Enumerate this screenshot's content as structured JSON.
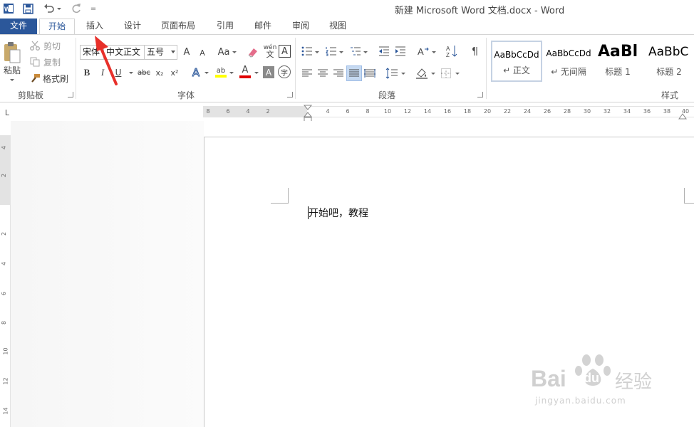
{
  "window": {
    "title": "新建 Microsoft Word 文档.docx - Word"
  },
  "qat": {
    "icons": [
      "word-logo-icon",
      "save-icon",
      "undo-icon",
      "redo-icon",
      "customize-qat-icon"
    ],
    "customize_glyph": "="
  },
  "tabs": [
    {
      "label": "文件"
    },
    {
      "label": "开始"
    },
    {
      "label": "插入"
    },
    {
      "label": "设计"
    },
    {
      "label": "页面布局"
    },
    {
      "label": "引用"
    },
    {
      "label": "邮件"
    },
    {
      "label": "审阅"
    },
    {
      "label": "视图"
    }
  ],
  "clipboard": {
    "paste": "粘贴",
    "cut": "剪切",
    "copy": "复制",
    "format_painter": "格式刷",
    "group": "剪贴板"
  },
  "font": {
    "font_ascii": "宋体",
    "font_east_asian": "中文正文",
    "size": "五号",
    "grow": "A",
    "shrink": "A",
    "change_case": "Aa",
    "phonetic_top": "wén",
    "phonetic_bottom": "文",
    "char_border": "A",
    "bold": "B",
    "italic": "I",
    "underline": "U",
    "strikethrough": "abc",
    "subscript": "x₂",
    "superscript": "x²",
    "text_effects": "A",
    "highlight": "ab",
    "font_color": "A",
    "char_shading": "A",
    "enclose_char": "字",
    "group": "字体"
  },
  "paragraph": {
    "group": "段落"
  },
  "styles": {
    "group": "样式",
    "items": [
      {
        "sample": "AaBbCcDd",
        "name": "↵ 正文"
      },
      {
        "sample": "AaBbCcDd",
        "name": "↵ 无间隔"
      },
      {
        "sample": "AaBl",
        "name": "标题 1"
      },
      {
        "sample": "AaBbC",
        "name": "标题 2"
      }
    ]
  },
  "ruler": {
    "corner": "L",
    "horizontal_left": [
      "8",
      "6",
      "4",
      "2"
    ],
    "horizontal_right": [
      "2",
      "4",
      "6",
      "8",
      "10",
      "12",
      "14",
      "16",
      "18",
      "20",
      "22",
      "24",
      "26",
      "28",
      "30",
      "32",
      "34",
      "36",
      "38",
      "40"
    ],
    "vertical": [
      "4",
      "2",
      "2",
      "4",
      "6",
      "8",
      "10",
      "12",
      "14"
    ]
  },
  "document": {
    "text": "开始吧，教程"
  },
  "watermark": {
    "brand_latin": "Bai",
    "brand_du": "du",
    "brand_cn": "经验",
    "url": "jingyan.baidu.com"
  },
  "colors": {
    "accent": "#2b579a",
    "highlight_yellow": "#ffff00",
    "font_red": "#e00000",
    "annotation_arrow": "#e8302a"
  }
}
